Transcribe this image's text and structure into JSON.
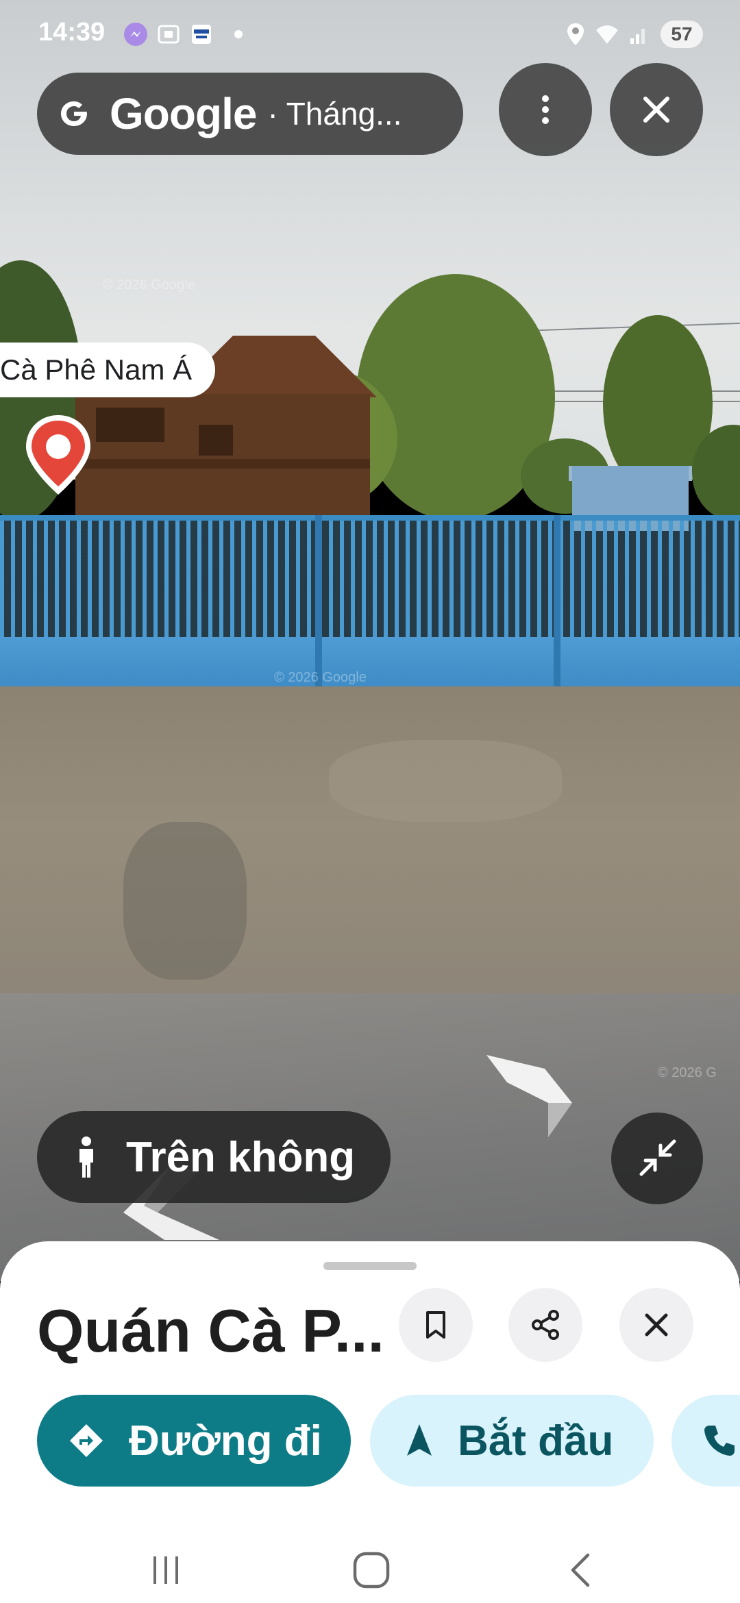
{
  "status_bar": {
    "time": "14:39",
    "icons": [
      "messenger-icon",
      "screenshot-icon",
      "acb-one-icon",
      "dot-icon",
      "location-icon",
      "wifi-icon",
      "signal-icon"
    ],
    "battery": "57"
  },
  "top_bar": {
    "brand": "Google",
    "subtitle": "· Tháng...",
    "menu_icon": "more-vert-icon",
    "close_icon": "close-icon"
  },
  "street_view": {
    "place_label": "Cà Phê Nam Á",
    "watermark_1": "© 2026 Google",
    "watermark_2": "© 2026 G"
  },
  "controls": {
    "view_mode_label": "Trên không",
    "view_mode_icon": "pegman-icon",
    "collapse_icon": "collapse-icon"
  },
  "sheet": {
    "title": "Quán Cà P...",
    "save_icon": "bookmark-icon",
    "share_icon": "share-icon",
    "close_icon": "close-icon",
    "directions_label": "Đường đi",
    "start_label": "Bắt đầu",
    "call_icon": "phone-icon"
  },
  "colors": {
    "primary_chip": "#0e7c86",
    "secondary_chip": "#d8f3fb",
    "pin_red": "#e5463a"
  }
}
